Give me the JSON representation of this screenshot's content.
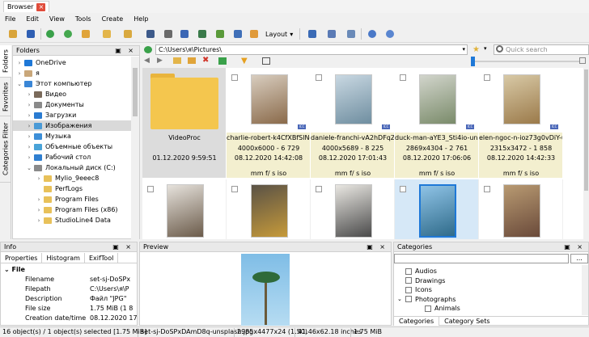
{
  "window": {
    "tab_title": "Browser",
    "close_glyph": "×"
  },
  "menu": [
    "File",
    "Edit",
    "View",
    "Tools",
    "Create",
    "Help"
  ],
  "toolbar": {
    "layout_label": "Layout",
    "layout_arrow": "▾"
  },
  "side_tabs": [
    "Folders",
    "Favorites",
    "Categories Filter"
  ],
  "folders_panel": {
    "title": "Folders",
    "controls": "▣ ×",
    "tree": [
      {
        "label": "OneDrive",
        "indent": 0,
        "arrow": "›",
        "icon_color": "#1e78d7"
      },
      {
        "label": "я",
        "indent": 0,
        "arrow": "›",
        "icon_color": "#c9a77a"
      },
      {
        "label": "Этот компьютер",
        "indent": 0,
        "arrow": "⌄",
        "icon_color": "#3a86d6"
      },
      {
        "label": "Видео",
        "indent": 1,
        "arrow": "›",
        "icon_color": "#7a6a5a"
      },
      {
        "label": "Документы",
        "indent": 1,
        "arrow": "›",
        "icon_color": "#8a8a8a"
      },
      {
        "label": "Загрузки",
        "indent": 1,
        "arrow": "›",
        "icon_color": "#2a7bd1"
      },
      {
        "label": "Изображения",
        "indent": 1,
        "arrow": "›",
        "icon_color": "#4a9ad6",
        "selected": true
      },
      {
        "label": "Музыка",
        "indent": 1,
        "arrow": "›",
        "icon_color": "#3d8fd8"
      },
      {
        "label": "Объемные объекты",
        "indent": 1,
        "arrow": "›",
        "icon_color": "#4aa3d8"
      },
      {
        "label": "Рабочий стол",
        "indent": 1,
        "arrow": "›",
        "icon_color": "#2f7fd0"
      },
      {
        "label": "Локальный диск (C:)",
        "indent": 1,
        "arrow": "⌄",
        "icon_color": "#8a8a8a"
      },
      {
        "label": "Mylio_9eeec8",
        "indent": 2,
        "arrow": "›",
        "icon_color": "#e8c15a"
      },
      {
        "label": "PerfLogs",
        "indent": 2,
        "arrow": "",
        "icon_color": "#e8c15a"
      },
      {
        "label": "Program Files",
        "indent": 2,
        "arrow": "›",
        "icon_color": "#e8c15a"
      },
      {
        "label": "Program Files (x86)",
        "indent": 2,
        "arrow": "›",
        "icon_color": "#e8c15a"
      },
      {
        "label": "StudioLine4 Data",
        "indent": 2,
        "arrow": "›",
        "icon_color": "#e8c15a"
      }
    ]
  },
  "address": {
    "path": "C:\\Users\\я\\Pictures\\",
    "search_placeholder": "Quick search"
  },
  "thumbnails": [
    {
      "name": "VideoProc",
      "dim": "",
      "date": "01.12.2020 9:59:51",
      "exif": "",
      "folder": true
    },
    {
      "name": "charlie-robert-k4CfXBfSlNg-u...",
      "dim": "4000x6000 - 6 729",
      "date": "08.12.2020 14:42:08",
      "exif": "mm f/ s iso",
      "colors": [
        "#d8cdbf",
        "#8a6a4a"
      ]
    },
    {
      "name": "daniele-franchi-vA2hDFqZA6...",
      "dim": "4000x5689 - 8 225",
      "date": "08.12.2020 17:01:43",
      "exif": "mm f/ s iso",
      "colors": [
        "#c9d8e2",
        "#6f8ea0"
      ]
    },
    {
      "name": "duck-man-aYE3_Sti4io-unspl...",
      "dim": "2869x4304 - 2 761",
      "date": "08.12.2020 17:06:06",
      "exif": "mm f/ s iso",
      "colors": [
        "#d2d5cc",
        "#7a8b6a"
      ]
    },
    {
      "name": "elen-ngoc-n-ioz73g0vDiY-u...",
      "dim": "2315x3472 - 1 858",
      "date": "08.12.2020 14:42:33",
      "exif": "mm f/ s iso",
      "colors": [
        "#d8c9a6",
        "#9b7a4a"
      ]
    }
  ],
  "thumbnails_row2": [
    {
      "colors": [
        "#e6e2dc",
        "#6b5b4a"
      ]
    },
    {
      "colors": [
        "#5a5246",
        "#c69a3a"
      ]
    },
    {
      "colors": [
        "#e9e7e2",
        "#4a4a4a"
      ]
    },
    {
      "colors": [
        "#8fc3e6",
        "#2f6b8a"
      ],
      "selected": true
    },
    {
      "colors": [
        "#b89a72",
        "#6a4a3a"
      ]
    }
  ],
  "info_panel": {
    "title": "Info",
    "controls": "▣ ×",
    "tabs": [
      "Properties",
      "Histogram",
      "ExifTool"
    ],
    "group": "File",
    "rows": [
      {
        "k": "Filename",
        "v": "set-sj-DoSPx"
      },
      {
        "k": "Filepath",
        "v": "C:\\Users\\я\\P"
      },
      {
        "k": "Description",
        "v": "Файл \"JPG\""
      },
      {
        "k": "File size",
        "v": "1.75 MiB (1 8"
      },
      {
        "k": "Creation date/time",
        "v": "08.12.2020 17"
      }
    ]
  },
  "preview_panel": {
    "title": "Preview",
    "controls": "▣ ×"
  },
  "categories_panel": {
    "title": "Categories",
    "controls": "▣ ×",
    "dots": "...",
    "items": [
      {
        "label": "Audios",
        "indent": 0,
        "arrow": ""
      },
      {
        "label": "Drawings",
        "indent": 0,
        "arrow": ""
      },
      {
        "label": "Icons",
        "indent": 0,
        "arrow": ""
      },
      {
        "label": "Photographs",
        "indent": 0,
        "arrow": "⌄"
      },
      {
        "label": "Animals",
        "indent": 1,
        "arrow": ""
      }
    ],
    "tabs": [
      "Categories",
      "Category Sets"
    ]
  },
  "status": {
    "selection": "16 object(s) / 1 object(s) selected [1.75 MiB]",
    "filename": "set-sj-DoSPxDAmD8q-unsplash.jpg",
    "dimensions": "2985x4477x24 (1.50)",
    "inches": "41.46x62.18 inches",
    "size": "1.75 MiB"
  }
}
